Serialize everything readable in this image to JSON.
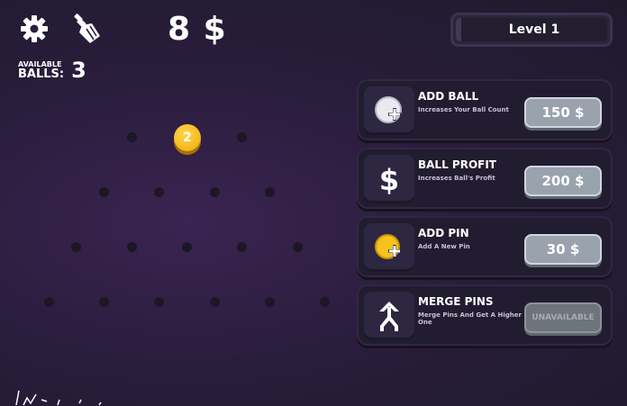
{
  "hud": {
    "money": "8 $",
    "balls_label_line1": "AVAILABLE",
    "balls_label_line2": "BALLS:",
    "balls_count": "3",
    "level": "Level 1"
  },
  "board": {
    "ball_value": "2",
    "ball_color": "#f5b81c"
  },
  "shop": [
    {
      "title": "ADD BALL",
      "desc": "Increases Your Ball Count",
      "price": "150 $",
      "icon": "add-ball-icon",
      "available": true
    },
    {
      "title": "BALL PROFIT",
      "desc": "Increases Ball's Profit",
      "price": "200 $",
      "icon": "dollar-icon",
      "available": true
    },
    {
      "title": "ADD PIN",
      "desc": "Add A New Pin",
      "price": "30 $",
      "icon": "add-pin-icon",
      "available": true
    },
    {
      "title": "MERGE PINS",
      "desc": "Merge Pins And Get A Higher One",
      "price": "UNAVAILABLE",
      "icon": "merge-arrow-icon",
      "available": false
    }
  ],
  "colors": {
    "button": "#9aa3ad",
    "button_disabled": "#6d747c",
    "card": "#221c31",
    "ball_gold": "#f5b81c"
  }
}
